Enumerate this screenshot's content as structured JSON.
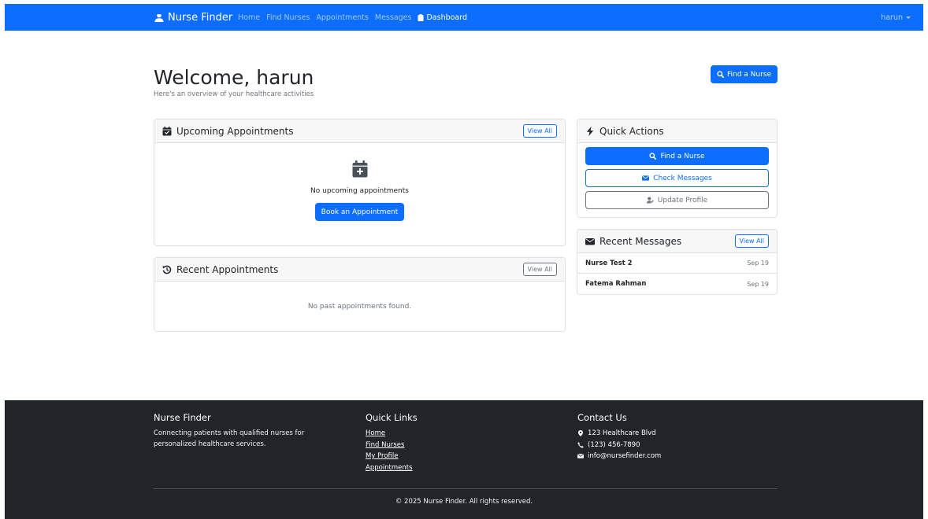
{
  "navbar": {
    "brand": "Nurse Finder",
    "links": [
      "Home",
      "Find Nurses",
      "Appointments",
      "Messages"
    ],
    "active_link": "Dashboard",
    "user": "harun"
  },
  "header": {
    "title": "Welcome, harun",
    "subtitle": "Here's an overview of your healthcare activities",
    "find_button": "Find a Nurse"
  },
  "upcoming": {
    "title": "Upcoming Appointments",
    "view_all": "View All",
    "empty_text": "No upcoming appointments",
    "book_button": "Book an Appointment"
  },
  "recent": {
    "title": "Recent Appointments",
    "view_all": "View All",
    "empty_text": "No past appointments found."
  },
  "quick_actions": {
    "title": "Quick Actions",
    "find": "Find a Nurse",
    "messages": "Check Messages",
    "profile": "Update Profile"
  },
  "recent_messages": {
    "title": "Recent Messages",
    "view_all": "View All",
    "items": [
      {
        "name": "Nurse Test 2",
        "date": "Sep 19"
      },
      {
        "name": "Fatema Rahman",
        "date": "Sep 19"
      }
    ]
  },
  "footer": {
    "brand_title": "Nurse Finder",
    "brand_text": "Connecting patients with qualified nurses for personalized healthcare services.",
    "links_title": "Quick Links",
    "links": [
      "Home",
      "Find Nurses",
      "My Profile",
      "Appointments"
    ],
    "contact_title": "Contact Us",
    "address": "123 Healthcare Blvd",
    "phone": "(123) 456-7890",
    "email": "info@nursefinder.com",
    "copyright": "© 2025 Nurse Finder. All rights reserved."
  },
  "colors": {
    "primary": "#0d6efd",
    "footer_bg": "#212529",
    "muted": "#6c757d"
  }
}
